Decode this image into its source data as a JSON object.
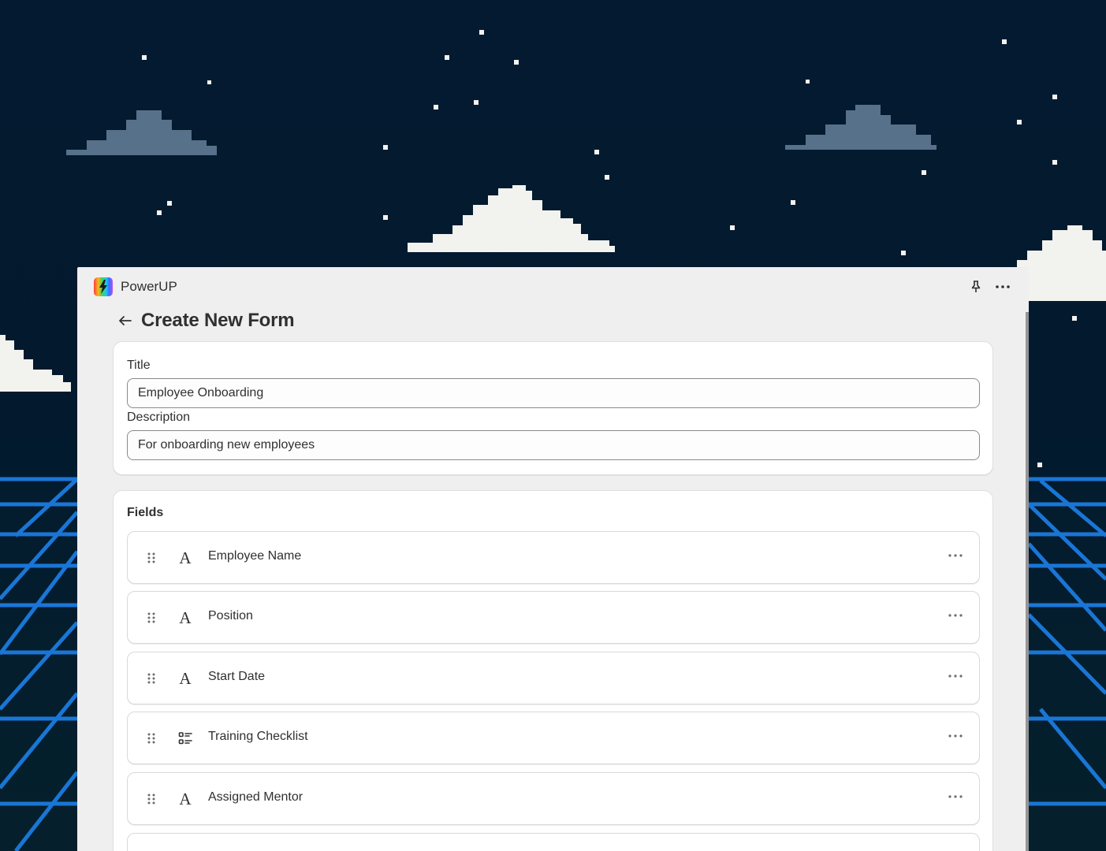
{
  "app": {
    "name": "PowerUP",
    "logo_icon": "lightning-bolt-icon",
    "pin_icon": "pin-icon",
    "more_icon": "more-horizontal-icon"
  },
  "page": {
    "back_icon": "arrow-left-icon",
    "title": "Create New Form"
  },
  "form": {
    "title_label": "Title",
    "title_value": "Employee Onboarding",
    "description_label": "Description",
    "description_value": "For onboarding new employees"
  },
  "fields": {
    "heading": "Fields",
    "items": [
      {
        "name": "Employee Name",
        "type_icon": "text-type-icon"
      },
      {
        "name": "Position",
        "type_icon": "text-type-icon"
      },
      {
        "name": "Start Date",
        "type_icon": "text-type-icon"
      },
      {
        "name": "Training Checklist",
        "type_icon": "checklist-type-icon"
      },
      {
        "name": "Assigned Mentor",
        "type_icon": "text-type-icon"
      }
    ]
  },
  "colors": {
    "sky": "#02192e",
    "window_bg": "#efefef",
    "card_bg": "#ffffff",
    "text": "#303030",
    "grid_blue": "#1a76d6"
  }
}
